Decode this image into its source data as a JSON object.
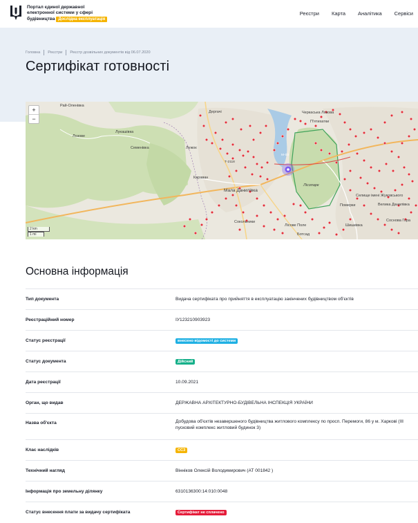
{
  "header": {
    "logo_line1": "Портал єдиної державної",
    "logo_line2": "електронної системи у сфері",
    "logo_line3": "будівництва",
    "test_badge": "Дослідна експлуатація",
    "nav": [
      "Реєстри",
      "Карта",
      "Аналітика",
      "Сервіси"
    ]
  },
  "breadcrumb": [
    "Головна",
    "Реєстри",
    "Реєстр дозвільних документів від 06.07.2020"
  ],
  "page_title": "Сертифікат готовності",
  "map": {
    "zoom_in": "+",
    "zoom_out": "−",
    "scale_km": "2 km",
    "scale_mi": "1 mi",
    "places": [
      {
        "name": "Дергачі"
      },
      {
        "name": "Черкаська Лозова"
      },
      {
        "name": "П'ятихатки"
      },
      {
        "name": "Лозове"
      },
      {
        "name": "Рай-Оленівка"
      },
      {
        "name": "Семенівка"
      },
      {
        "name": "Лукашівка"
      },
      {
        "name": "Лужок"
      },
      {
        "name": "Караван"
      },
      {
        "name": "Мала Данилівка"
      },
      {
        "name": "Лісопарк"
      },
      {
        "name": "Сокольники"
      },
      {
        "name": "Селище імені Жуковського"
      },
      {
        "name": "Велика Данилівка"
      },
      {
        "name": "Померки"
      },
      {
        "name": "Шишківка"
      },
      {
        "name": "Соснова Гора"
      },
      {
        "name": "Лісове Поле"
      },
      {
        "name": "Ботсад"
      },
      {
        "name": "М-03"
      },
      {
        "name": "Т-2118"
      }
    ],
    "colors": {
      "poi": "#e0323a",
      "forest": "#c8dcae",
      "boundary": "#3fa35a",
      "marker": "#7b5cf0"
    }
  },
  "section_title": "Основна інформація",
  "rows": [
    {
      "label": "Тип документа",
      "value": "Видача сертифіката про прийняття в експлуатацію закінчених будівництвом об'єктів"
    },
    {
      "label": "Реєстраційний номер",
      "value": "IУ123210903923"
    },
    {
      "label": "Статус реєстрації",
      "badge": "внесено відомості до системи",
      "badge_color": "#1fb0e3"
    },
    {
      "label": "Статус документа",
      "badge": "Дійсний",
      "badge_color": "#17b08a"
    },
    {
      "label": "Дата реєстрації",
      "value": "10.09.2021"
    },
    {
      "label": "Орган, що видав",
      "value": "ДЕРЖАВНА АРХІТЕКТУРНО-БУДІВЕЛЬНА ІНСПЕКЦІЯ УКРАЇНИ"
    },
    {
      "label": "Назва об'єкта",
      "value": "Добудова об'єктів незавершеного будівництва житлового комплексу по просп. Перемоги, 86 у м. Харкові (III пусковий комплекс житловий будинок 3)"
    },
    {
      "label": "Клас наслідків",
      "badge": "СС3",
      "badge_color": "#f5b400"
    },
    {
      "label": "Технічний нагляд",
      "value": "Вінніков Олексій Володимирович  (АТ 001842 )"
    },
    {
      "label": "Інформація про земельну ділянку",
      "value": "6310136300:14:010:0048"
    },
    {
      "label": "Статус внесення плати за видачу сертифіката",
      "badge": "Сертифікат не сплачено",
      "badge_color": "#e51c3a"
    }
  ]
}
